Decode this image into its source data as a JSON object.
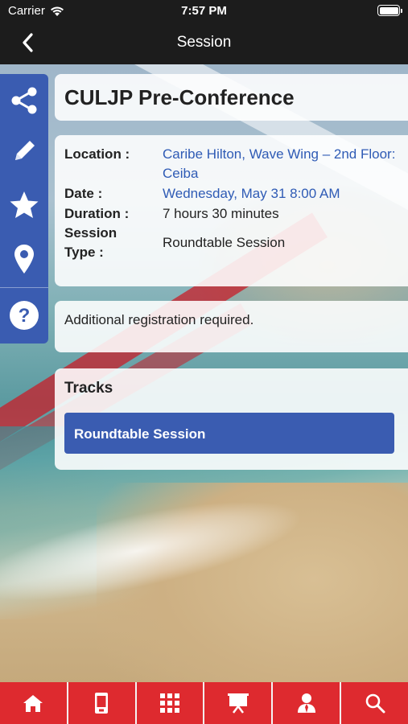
{
  "status_bar": {
    "carrier": "Carrier",
    "time": "7:57 PM"
  },
  "nav": {
    "title": "Session",
    "back_icon": "chevron-left-icon"
  },
  "sidebar": {
    "items": [
      {
        "icon": "share-icon"
      },
      {
        "icon": "pencil-icon"
      },
      {
        "icon": "star-icon"
      },
      {
        "icon": "location-pin-icon"
      },
      {
        "icon": "help-icon"
      }
    ]
  },
  "session": {
    "title": "CULJP Pre-Conference",
    "location_label": "Location :",
    "location_value": "Caribe Hilton, Wave Wing – 2nd Floor: Ceiba",
    "date_label": "Date :",
    "date_value": "Wednesday, May 31 8:00 AM",
    "duration_label": "Duration :",
    "duration_value": "7 hours 30 minutes",
    "type_label": "Session Type :",
    "type_value": "Roundtable Session",
    "notice": "Additional registration required.",
    "tracks_header": "Tracks",
    "tracks": [
      "Roundtable Session"
    ]
  },
  "tabbar": {
    "items": [
      {
        "icon": "home-icon"
      },
      {
        "icon": "mobile-icon"
      },
      {
        "icon": "grid-icon"
      },
      {
        "icon": "presentation-board-icon"
      },
      {
        "icon": "speaker-icon"
      },
      {
        "icon": "search-icon"
      }
    ]
  },
  "colors": {
    "nav_bg": "#1c1c1c",
    "accent_blue": "#3a5cb1",
    "tabbar_red": "#de2a2f",
    "link_blue": "#2f5bb5"
  }
}
